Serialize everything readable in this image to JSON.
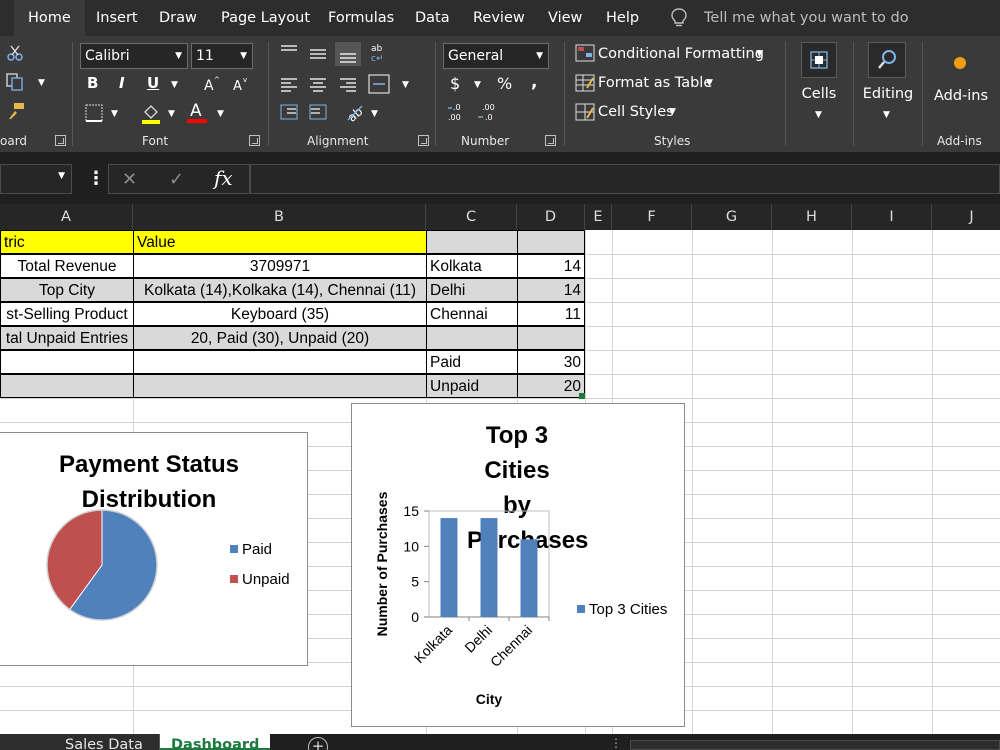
{
  "menu": {
    "tabs": [
      "Home",
      "Insert",
      "Draw",
      "Page Layout",
      "Formulas",
      "Data",
      "Review",
      "View",
      "Help"
    ],
    "active": "Home",
    "tell_me": "Tell me what you want to do"
  },
  "ribbon": {
    "font_name": "Calibri",
    "font_size": "11",
    "number_format": "General",
    "bold": "B",
    "italic": "I",
    "underline": "U",
    "currency": "$",
    "percent": "%",
    "comma": ",",
    "styles": {
      "conditional": "Conditional Formatting",
      "table": "Format as Table",
      "cell_styles": "Cell Styles"
    },
    "cells": "Cells",
    "editing": "Editing",
    "addins": "Add-ins",
    "groups": {
      "clipboard": "oard",
      "font": "Font",
      "alignment": "Alignment",
      "number": "Number",
      "styles": "Styles",
      "addins": "Add-ins"
    }
  },
  "formula_bar": {
    "cancel": "✕",
    "enter": "✓",
    "fx": "fx",
    "more": "⋮"
  },
  "grid": {
    "columns": [
      "A",
      "B",
      "C",
      "D",
      "E",
      "F",
      "G",
      "H",
      "I",
      "J"
    ],
    "table": {
      "header": [
        "tric",
        "Value"
      ],
      "rows": [
        [
          "Total Revenue",
          "3709971"
        ],
        [
          "Top City",
          "Kolkata (14),Kolkaka (14), Chennai (11)"
        ],
        [
          "st-Selling Product",
          "Keyboard (35)"
        ],
        [
          "tal Unpaid Entries",
          "20, Paid (30), Unpaid (20)"
        ]
      ]
    },
    "side": [
      {
        "label": "Kolkata",
        "value": "14"
      },
      {
        "label": "Delhi",
        "value": "14"
      },
      {
        "label": "Chennai",
        "value": "11"
      },
      {
        "label": "",
        "value": ""
      },
      {
        "label": "Paid",
        "value": "30"
      },
      {
        "label": "Unpaid",
        "value": "20"
      }
    ]
  },
  "chart_data": [
    {
      "type": "pie",
      "title": "Payment Status Distribution",
      "categories": [
        "Paid",
        "Unpaid"
      ],
      "values": [
        30,
        20
      ],
      "colors": [
        "#4f81bd",
        "#c0504d"
      ],
      "legend": "right"
    },
    {
      "type": "bar",
      "title": "Top 3 Cities by Purchases",
      "categories": [
        "Kolkata",
        "Delhi",
        "Chennai"
      ],
      "series": [
        {
          "name": "Top 3 Cities",
          "values": [
            14,
            14,
            11
          ]
        }
      ],
      "xlabel": "City",
      "ylabel": "Number of Purchases",
      "ylim": [
        0,
        15
      ],
      "yticks": [
        0,
        5,
        10,
        15
      ],
      "color": "#4f81bd",
      "legend": "right"
    }
  ],
  "sheets": {
    "tabs": [
      "Sales Data",
      "Dashboard"
    ],
    "active": "Dashboard",
    "add": "+"
  },
  "colors": {
    "yellow_header": "#ffff00",
    "gray_fill": "#d9d9d9",
    "accent_green": "#1d7a40"
  }
}
